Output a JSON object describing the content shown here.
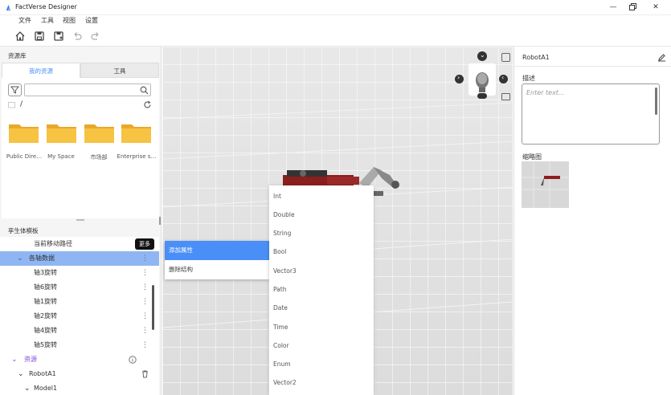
{
  "app": {
    "title": "FactVerse Designer"
  },
  "menu": [
    "文件",
    "工具",
    "视图",
    "设置"
  ],
  "library": {
    "label": "资源库",
    "tabs": [
      "我的资源",
      "工具"
    ],
    "path": "/",
    "folders": [
      "Public Dire…",
      "My Space",
      "市场部",
      "Enterprise s…"
    ]
  },
  "twin": {
    "label": "孪生体模板",
    "tooltip": "更多",
    "rows": [
      {
        "label": "当前移动路径",
        "indent": 1,
        "state": "normal"
      },
      {
        "label": "各轴数据",
        "indent": 0,
        "state": "selected",
        "expand": true
      },
      {
        "label": "轴3旋转",
        "indent": 1,
        "state": "normal"
      },
      {
        "label": "轴6旋转",
        "indent": 1,
        "state": "normal"
      },
      {
        "label": "轴1旋转",
        "indent": 1,
        "state": "normal"
      },
      {
        "label": "轴2旋转",
        "indent": 1,
        "state": "normal"
      },
      {
        "label": "轴4旋转",
        "indent": 1,
        "state": "normal"
      },
      {
        "label": "轴5旋转",
        "indent": 1,
        "state": "normal"
      }
    ],
    "resources_label": "资源",
    "robot_label": "RobotA1",
    "model_label": "Model1"
  },
  "context_menu": [
    "添加属性",
    "删除结构"
  ],
  "submenu": [
    "Int",
    "Double",
    "String",
    "Bool",
    "Vector3",
    "Path",
    "Date",
    "Time",
    "Color",
    "Enum",
    "Vector2"
  ],
  "properties": {
    "name": "RobotA1",
    "desc_label": "描述",
    "desc_placeholder": "Enter text...",
    "thumb_label": "缩略图"
  },
  "colors": {
    "accent": "#4a8ff7",
    "selected_row": "#8fb6f3",
    "folder": "#f6c343",
    "purple": "#7b4fd6"
  }
}
